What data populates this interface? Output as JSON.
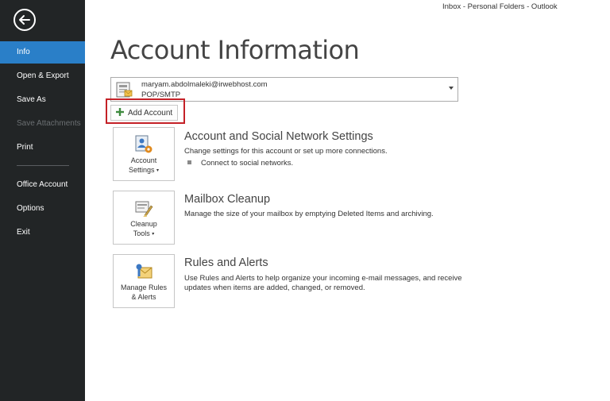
{
  "window": {
    "title": "Inbox - Personal Folders - Outlook"
  },
  "sidebar": {
    "back_icon": "back-arrow-icon",
    "items": [
      {
        "label": "Info",
        "state": "active"
      },
      {
        "label": "Open & Export",
        "state": "normal"
      },
      {
        "label": "Save As",
        "state": "normal"
      },
      {
        "label": "Save Attachments",
        "state": "disabled"
      },
      {
        "label": "Print",
        "state": "normal"
      },
      {
        "label": "Office Account",
        "state": "normal"
      },
      {
        "label": "Options",
        "state": "normal"
      },
      {
        "label": "Exit",
        "state": "normal"
      }
    ]
  },
  "main": {
    "title": "Account Information",
    "account_selector": {
      "email": "maryam.abdolmaleki@irwebhost.com",
      "type": "POP/SMTP"
    },
    "add_account": {
      "label": "Add Account",
      "highlighted": true
    },
    "sections": [
      {
        "tile_label_line1": "Account",
        "tile_label_line2": "Settings",
        "tile_has_dropdown": true,
        "title": "Account and Social Network Settings",
        "description": "Change settings for this account or set up more connections.",
        "bullets": [
          "Connect to social networks."
        ]
      },
      {
        "tile_label_line1": "Cleanup",
        "tile_label_line2": "Tools",
        "tile_has_dropdown": true,
        "title": "Mailbox Cleanup",
        "description": "Manage the size of your mailbox by emptying Deleted Items and archiving."
      },
      {
        "tile_label_line1": "Manage Rules",
        "tile_label_line2": "& Alerts",
        "tile_has_dropdown": false,
        "title": "Rules and Alerts",
        "description_line1": "Use Rules and Alerts to help organize your incoming e-mail messages, and receive",
        "description_line2": "updates when items are added, changed, or removed."
      }
    ]
  },
  "colors": {
    "sidebar_bg": "#222526",
    "active_item": "#2a7fc8",
    "highlight_border": "#c42127",
    "add_icon": "#3e8a3e"
  }
}
